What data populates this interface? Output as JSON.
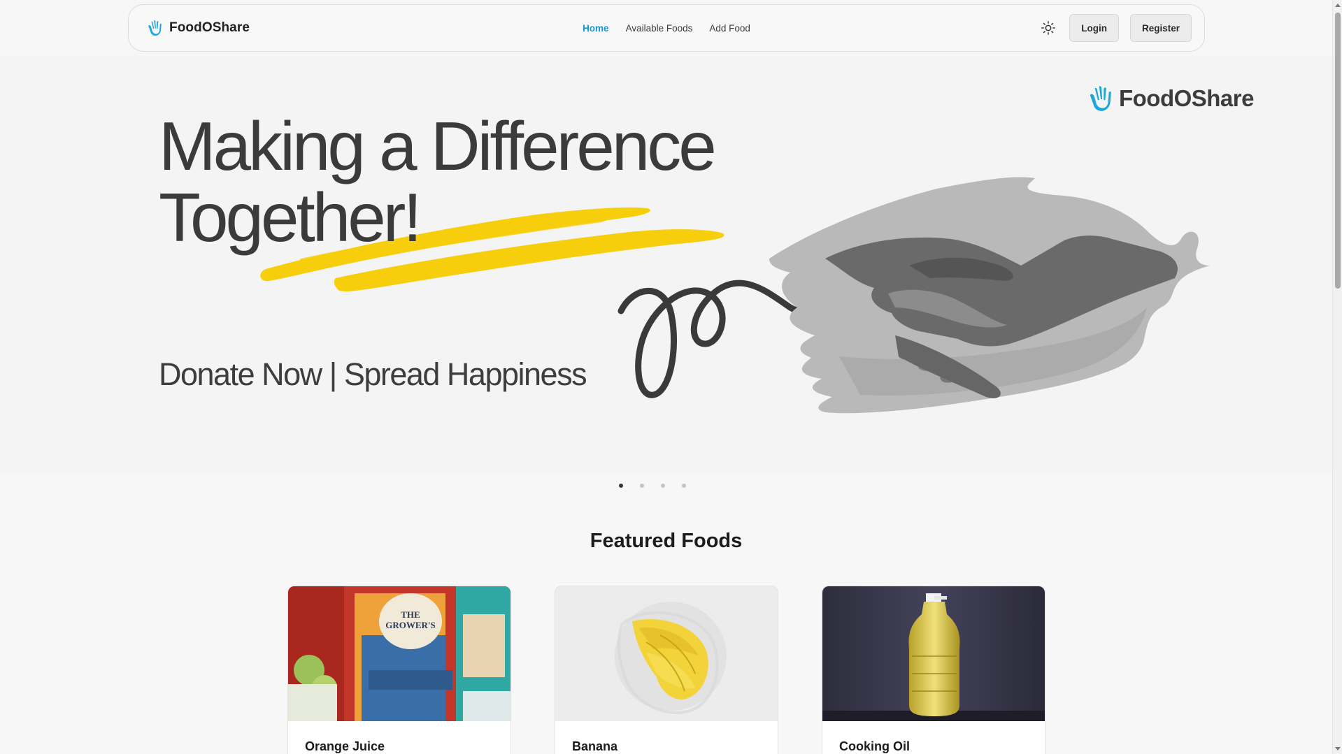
{
  "nav": {
    "brand": "FoodOShare",
    "links": [
      {
        "label": "Home",
        "active": true
      },
      {
        "label": "Available Foods",
        "active": false
      },
      {
        "label": "Add Food",
        "active": false
      }
    ],
    "theme_icon": "sun-icon",
    "login_label": "Login",
    "register_label": "Register"
  },
  "hero": {
    "brand": "FoodOShare",
    "title_line1": "Making a Difference",
    "title_line2": "Together!",
    "subtitle": "Donate Now | Spread Happiness",
    "accent_color": "#f7cc00",
    "brand_color": "#1aa7dc"
  },
  "carousel": {
    "slide_count": 4,
    "active_index": 0
  },
  "featured": {
    "title": "Featured Foods",
    "cards": [
      {
        "name": "Orange Juice",
        "image": "orange-juice-carton-image"
      },
      {
        "name": "Banana",
        "image": "banana-bunch-image"
      },
      {
        "name": "Cooking Oil",
        "image": "cooking-oil-bottle-image"
      }
    ]
  }
}
